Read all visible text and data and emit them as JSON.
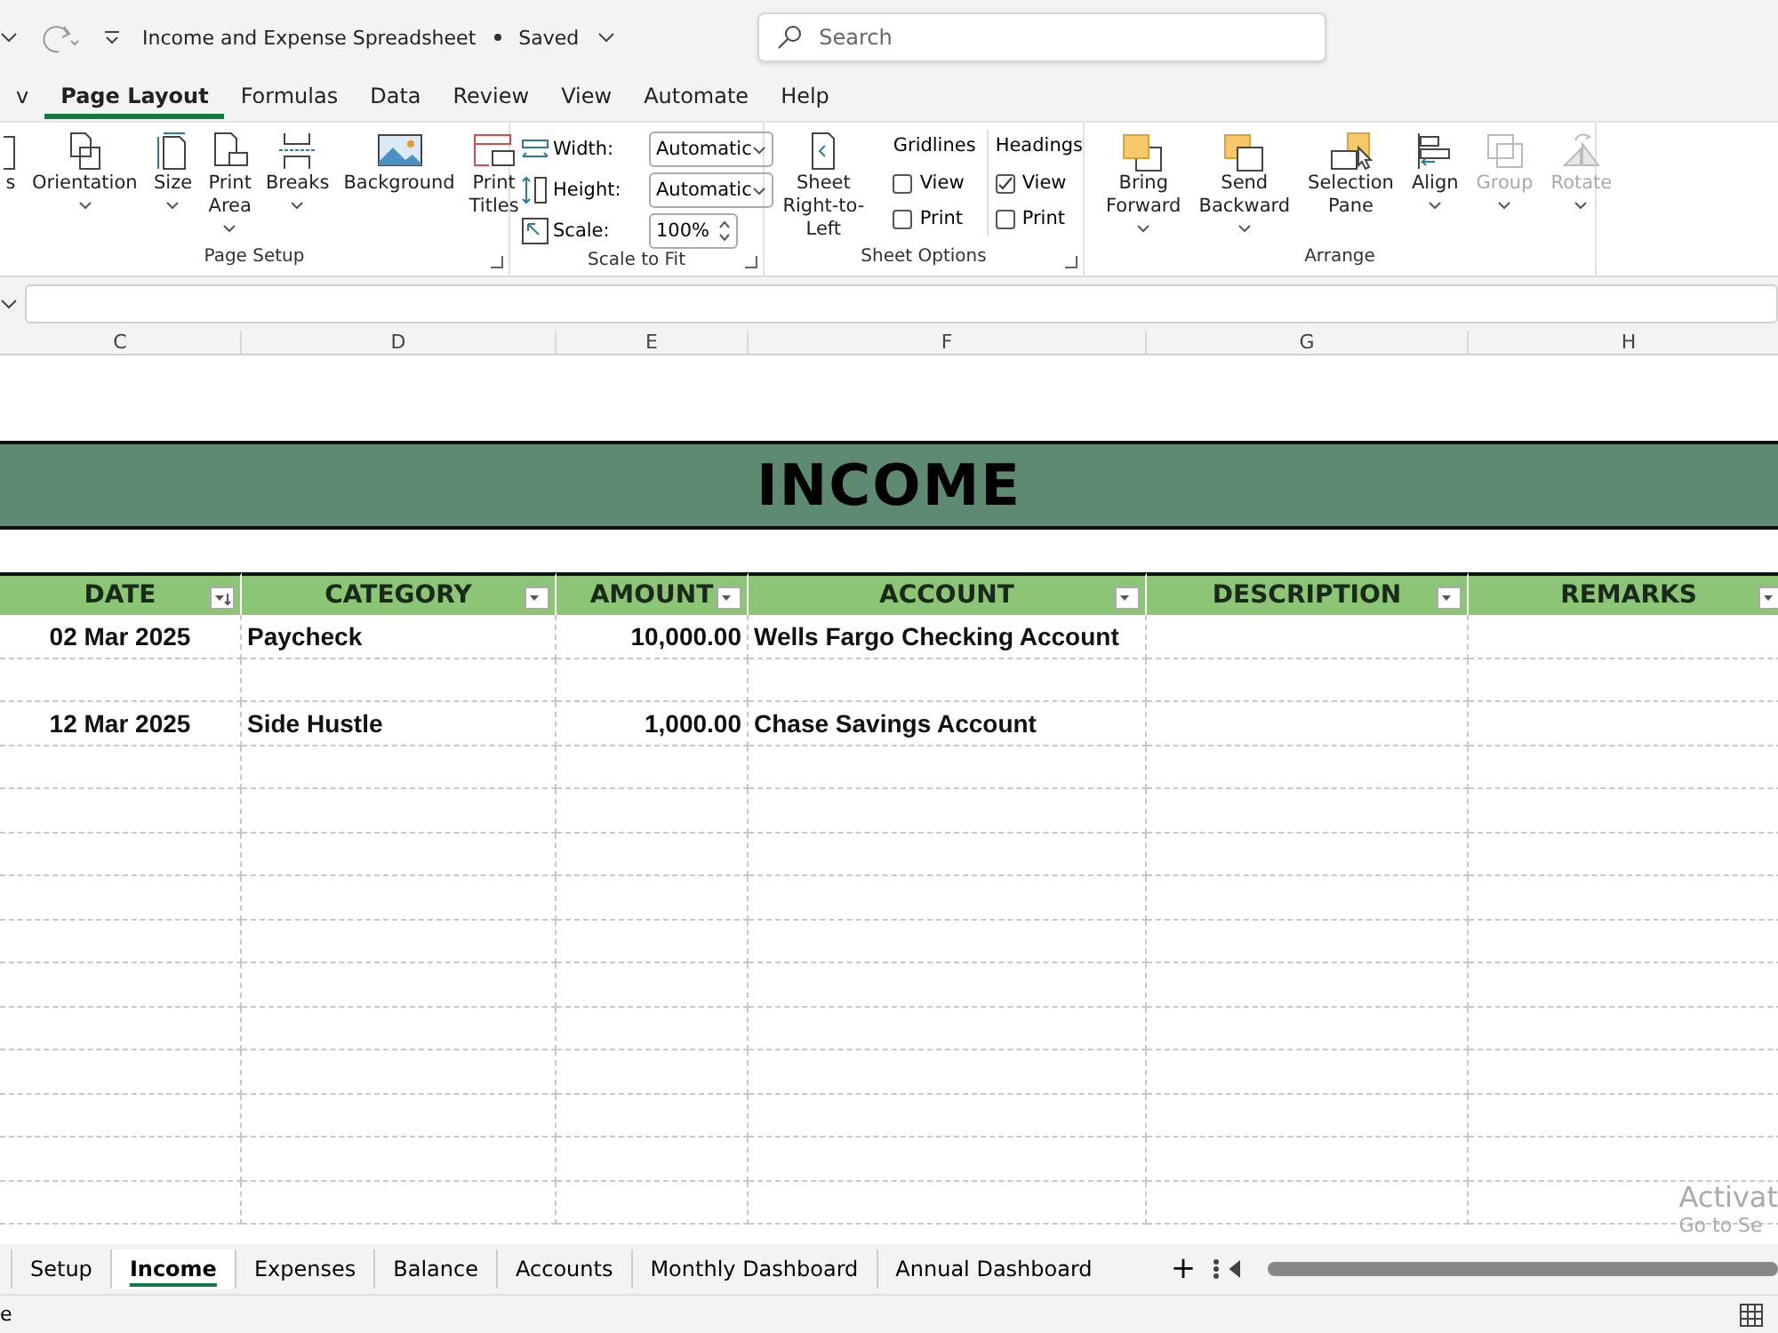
{
  "title_bar": {
    "document_title": "Income and Expense Spreadsheet",
    "save_state": "Saved",
    "search": {
      "placeholder": "Search"
    }
  },
  "ribbon_tabs": [
    {
      "label": "v",
      "selected": false
    },
    {
      "label": "Page Layout",
      "selected": true
    },
    {
      "label": "Formulas",
      "selected": false
    },
    {
      "label": "Data",
      "selected": false
    },
    {
      "label": "Review",
      "selected": false
    },
    {
      "label": "View",
      "selected": false
    },
    {
      "label": "Automate",
      "selected": false
    },
    {
      "label": "Help",
      "selected": false
    }
  ],
  "page_setup": {
    "name": "Page Setup",
    "buttons": [
      {
        "kind": "cut",
        "label": "s",
        "dropdown": false
      },
      {
        "kind": "orientation",
        "label": "Orientation",
        "dropdown": true
      },
      {
        "kind": "size",
        "label": "Size",
        "dropdown": true
      },
      {
        "kind": "print_area",
        "label": "Print Area",
        "dropdown": true
      },
      {
        "kind": "breaks",
        "label": "Breaks",
        "dropdown": true
      },
      {
        "kind": "background",
        "label": "Background",
        "dropdown": false
      },
      {
        "kind": "print_titles",
        "label": "Print Titles",
        "dropdown": false
      }
    ]
  },
  "scale_to_fit": {
    "name": "Scale to Fit",
    "fields": [
      {
        "kind": "dropdown",
        "label": "Width:",
        "value": "Automatic"
      },
      {
        "kind": "dropdown",
        "label": "Height:",
        "value": "Automatic"
      },
      {
        "kind": "spinner",
        "label": "Scale:",
        "value": "100%"
      }
    ]
  },
  "sheet_options": {
    "name": "Sheet Options",
    "rtl_button": "Sheet Right-to-Left",
    "groups": [
      {
        "title": "Gridlines",
        "options": [
          {
            "label": "View",
            "checked": false
          },
          {
            "label": "Print",
            "checked": false
          }
        ]
      },
      {
        "title": "Headings",
        "options": [
          {
            "label": "View",
            "checked": true
          },
          {
            "label": "Print",
            "checked": false
          }
        ]
      }
    ]
  },
  "arrange": {
    "name": "Arrange",
    "buttons": [
      {
        "kind": "bring_forward",
        "label": "Bring Forward",
        "dropdown": true,
        "disabled": false
      },
      {
        "kind": "send_backward",
        "label": "Send Backward",
        "dropdown": true,
        "disabled": false
      },
      {
        "kind": "selection_pane",
        "label": "Selection Pane",
        "dropdown": false,
        "disabled": false
      },
      {
        "kind": "align",
        "label": "Align",
        "dropdown": true,
        "disabled": false
      },
      {
        "kind": "group",
        "label": "Group",
        "dropdown": true,
        "disabled": true
      },
      {
        "kind": "rotate",
        "label": "Rotate",
        "dropdown": true,
        "disabled": true
      }
    ]
  },
  "column_letters": [
    "C",
    "D",
    "E",
    "F",
    "G",
    "H"
  ],
  "sheet": {
    "title": "INCOME",
    "columns": [
      {
        "label": "DATE",
        "sorted": true
      },
      {
        "label": "CATEGORY",
        "sorted": false
      },
      {
        "label": "AMOUNT",
        "sorted": false
      },
      {
        "label": "ACCOUNT",
        "sorted": false
      },
      {
        "label": "DESCRIPTION",
        "sorted": false
      },
      {
        "label": "REMARKS",
        "sorted": false
      }
    ],
    "rows": [
      {
        "date": "02 Mar 2025",
        "category": "Paycheck",
        "amount": "10,000.00",
        "account": "Wells Fargo Checking Account"
      },
      {},
      {
        "date": "12 Mar 2025",
        "category": "Side Hustle",
        "amount": "1,000.00",
        "account": "Chase Savings Account"
      }
    ]
  },
  "sheet_tabs": [
    {
      "label": "Setup",
      "selected": false
    },
    {
      "label": "Income",
      "selected": true
    },
    {
      "label": "Expenses",
      "selected": false
    },
    {
      "label": "Balance",
      "selected": false
    },
    {
      "label": "Accounts",
      "selected": false
    },
    {
      "label": "Monthly Dashboard",
      "selected": false
    },
    {
      "label": "Annual Dashboard",
      "selected": false
    }
  ],
  "add_sheet": "+",
  "activation_notice": [
    "Activat",
    "Go to Se"
  ],
  "status_bar": {
    "text": "e"
  }
}
